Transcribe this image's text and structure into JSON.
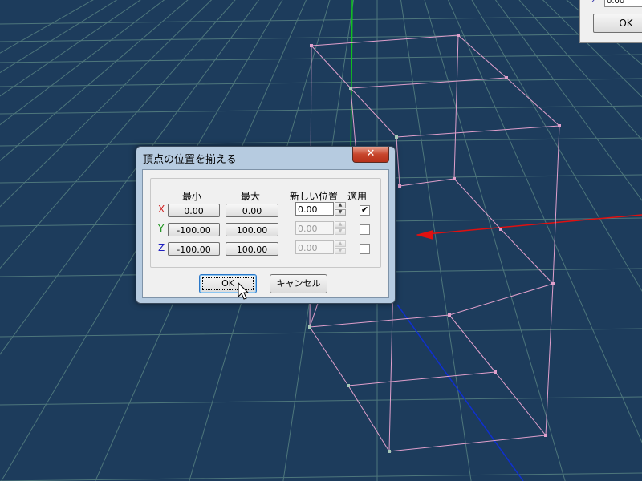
{
  "colors": {
    "background": "#1d3c5c",
    "grid": "#5e8a86",
    "mesh": "#e0a0cc",
    "vertex": "#a8c8b8",
    "axis_x": "#e01010",
    "axis_y": "#10c020",
    "axis_z": "#1030d0"
  },
  "corner_window": {
    "z_label": "Z",
    "z_value": "0.00",
    "ok_label": "OK"
  },
  "dialog": {
    "title": "頂点の位置を揃える",
    "close_glyph": "✕",
    "headers": {
      "min": "最小",
      "max": "最大",
      "new_pos": "新しい位置",
      "apply": "適用"
    },
    "rows": [
      {
        "axis": "X",
        "axis_color": "#d02020",
        "min": "0.00",
        "max": "0.00",
        "new_pos": "0.00",
        "enabled": true,
        "apply": true,
        "check_glyph": "✔"
      },
      {
        "axis": "Y",
        "axis_color": "#189018",
        "min": "-100.00",
        "max": "100.00",
        "new_pos": "0.00",
        "enabled": false,
        "apply": false,
        "check_glyph": ""
      },
      {
        "axis": "Z",
        "axis_color": "#2020c0",
        "min": "-100.00",
        "max": "100.00",
        "new_pos": "0.00",
        "enabled": false,
        "apply": false,
        "check_glyph": ""
      }
    ],
    "ok_label": "OK",
    "cancel_label": "キャンセル"
  },
  "spin_glyphs": {
    "up": "▲",
    "down": "▼"
  }
}
